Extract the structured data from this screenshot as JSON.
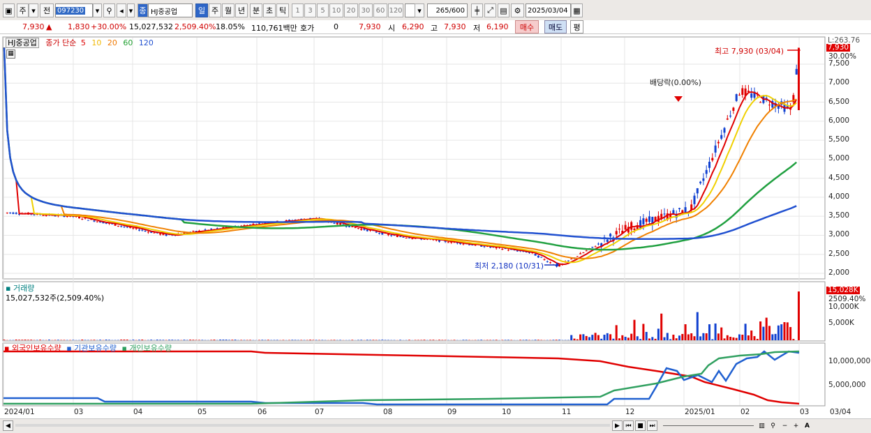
{
  "toolbar": {
    "period_unit": "주",
    "prev_label": "전",
    "code": "097230",
    "market_label": "종",
    "stock_name": "HJ중공업",
    "periods": [
      "일",
      "주",
      "월",
      "년",
      "분",
      "초",
      "틱"
    ],
    "intervals": [
      "1",
      "3",
      "5",
      "10",
      "20",
      "30",
      "60",
      "120"
    ],
    "count": "265",
    "count_total": "/600",
    "date": "2025/03/04"
  },
  "quote": {
    "price": "7,930",
    "change": "1,830",
    "change_pct": "+30.00%",
    "volume": "15,027,532",
    "volume_pct": "2,509.40%",
    "turnover_pct": "18.05%",
    "amount": "110,761백만",
    "hoga_label": "호가",
    "hoga_value": "0",
    "hoga_price": "7,930",
    "open_label": "시",
    "open": "6,290",
    "high_label": "고",
    "high": "7,930",
    "low_label": "저",
    "low": "6,190",
    "buy_label": "매수",
    "sell_label": "매도",
    "avg_label": "평"
  },
  "price_panel": {
    "legend_name": "HJ중공업",
    "legend_ma": "종가 단순",
    "ma_periods": [
      "5",
      "10",
      "20",
      "60",
      "120"
    ],
    "ma_colors": [
      "#e00000",
      "#f0b800",
      "#f07800",
      "#20a030",
      "#2050d0"
    ],
    "high_note": "최고 7,930 (03/04)",
    "low_note": "최저 2,180 (10/31)",
    "dividend_note": "배당락(0.00%)",
    "top_right_label": "L:263.76",
    "price_tag": "7,930",
    "pct_tag": "30.00%",
    "y_ticks": [
      "7,500",
      "7,000",
      "6,500",
      "6,000",
      "5,500",
      "5,000",
      "4,500",
      "4,000",
      "3,500",
      "3,000",
      "2,500",
      "2,000"
    ]
  },
  "volume_panel": {
    "legend": "거래량",
    "value_text": "15,027,532주(2,509.40%)",
    "tag_volume": "15,028K",
    "tag_pct": "2509.40%",
    "y_ticks": [
      "10,000K",
      "5,000K"
    ]
  },
  "holdings_panel": {
    "legends": [
      "외국인보유수량",
      "기관보유수량",
      "개인보유수량"
    ],
    "legend_colors": [
      "#e00000",
      "#2060d0",
      "#30a060"
    ],
    "y_ticks": [
      "10,000,000",
      "5,000,000"
    ]
  },
  "x_axis": {
    "labels": [
      "2024/01",
      "03",
      "04",
      "05",
      "06",
      "07",
      "08",
      "09",
      "10",
      "11",
      "12",
      "2025/01",
      "02",
      "03",
      "03/04"
    ]
  },
  "chart_data": {
    "type": "candlestick",
    "title": "HJ중공업",
    "y_range": [
      2000,
      7930
    ],
    "weekly_close_approx": [
      {
        "date": "2024/01",
        "value": 3600
      },
      {
        "date": "2024/03",
        "value": 3500
      },
      {
        "date": "2024/04",
        "value": 3000
      },
      {
        "date": "2024/05",
        "value": 3100
      },
      {
        "date": "2024/06",
        "value": 3300
      },
      {
        "date": "2024/07",
        "value": 3450
      },
      {
        "date": "2024/08",
        "value": 3000
      },
      {
        "date": "2024/09",
        "value": 2800
      },
      {
        "date": "2024/10",
        "value": 2550
      },
      {
        "date": "2024/10/31",
        "value": 2180
      },
      {
        "date": "2024/11",
        "value": 3200
      },
      {
        "date": "2024/12",
        "value": 3700
      },
      {
        "date": "2025/01",
        "value": 6800
      },
      {
        "date": "2025/02",
        "value": 6300
      },
      {
        "date": "2025/03/04",
        "value": 7930
      }
    ]
  }
}
